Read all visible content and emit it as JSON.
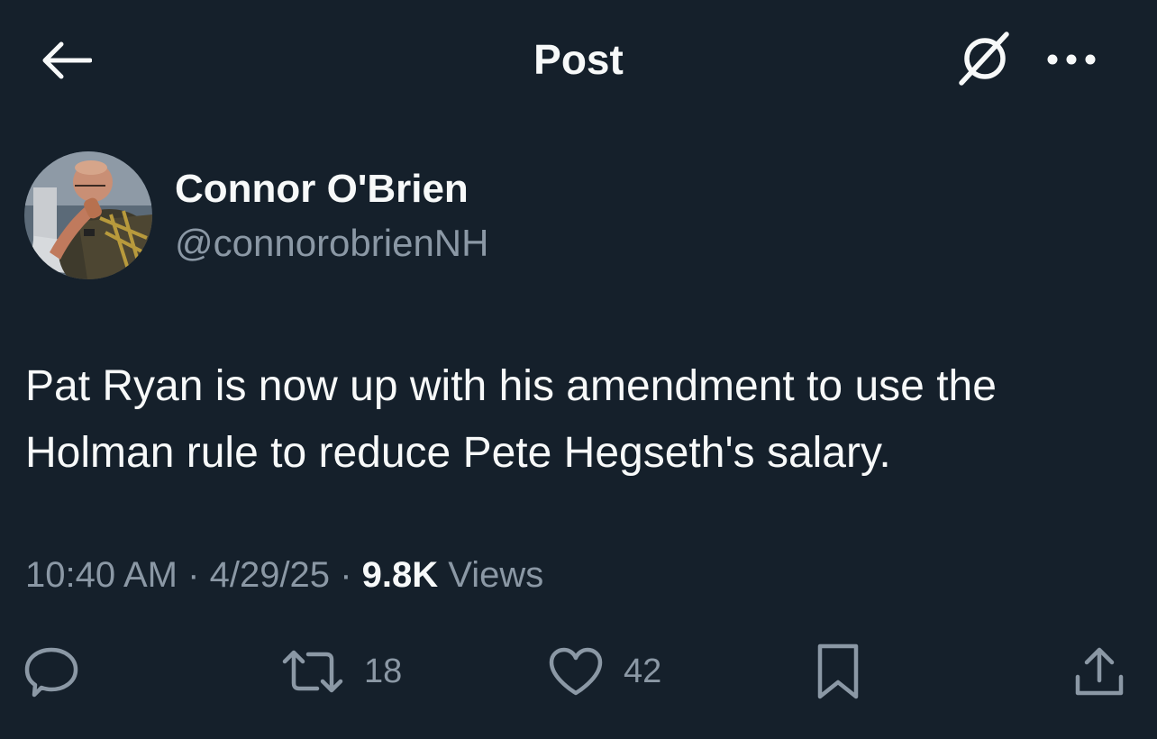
{
  "header": {
    "title": "Post",
    "back_icon": "arrow-left-icon",
    "grok_icon": "grok-icon",
    "more_icon": "more-horizontal-icon"
  },
  "post": {
    "author": {
      "name": "Connor O'Brien",
      "handle": "@connorobrienNH"
    },
    "text": "Pat Ryan is now up with his amendment to use the Holman rule to reduce Pete Hegseth's salary.",
    "meta": {
      "time": "10:40 AM",
      "separator": "·",
      "date": "4/29/25",
      "views_count": "9.8K",
      "views_label": "Views"
    },
    "actions": {
      "reply_icon": "reply-icon",
      "repost_icon": "repost-icon",
      "repost_count": "18",
      "like_icon": "heart-icon",
      "like_count": "42",
      "bookmark_icon": "bookmark-icon",
      "share_icon": "share-icon"
    }
  },
  "colors": {
    "background": "#15202b",
    "text_primary": "#f7f9f9",
    "text_secondary": "#8b98a5"
  }
}
